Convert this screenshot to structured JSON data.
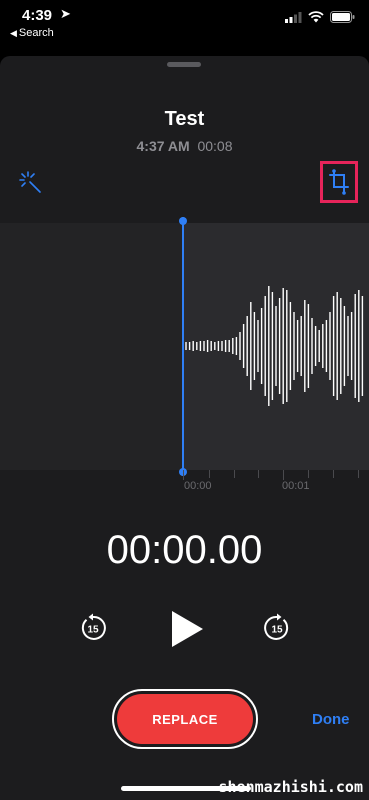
{
  "status_bar": {
    "time": "4:39",
    "back_label": "Search"
  },
  "header": {
    "title": "Test",
    "date": "4:37 AM",
    "duration": "00:08"
  },
  "icons": {
    "enhance": "magic-wand-icon",
    "trim": "crop-icon"
  },
  "waveform": {
    "timeline_labels": [
      "00:00",
      "00:01"
    ],
    "amplitudes": [
      4,
      4,
      5,
      4,
      5,
      5,
      6,
      5,
      4,
      5,
      5,
      6,
      6,
      8,
      9,
      14,
      22,
      30,
      44,
      34,
      26,
      38,
      50,
      60,
      54,
      40,
      48,
      58,
      56,
      44,
      34,
      26,
      30,
      46,
      42,
      28,
      20,
      16,
      22,
      26,
      34,
      50,
      54,
      48,
      40,
      30,
      34,
      52,
      56,
      50
    ]
  },
  "playback": {
    "elapsed": "00:00.00",
    "skip_back": "15",
    "skip_forward": "15"
  },
  "actions": {
    "replace_label": "REPLACE",
    "done_label": "Done"
  },
  "watermark": "shenmazhishi.com",
  "colors": {
    "accent": "#2f7ff5",
    "record": "#ee3b3b",
    "highlight": "#e6245a"
  }
}
